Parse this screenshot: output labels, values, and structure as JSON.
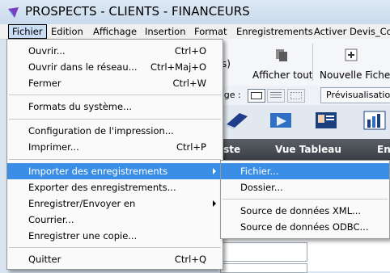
{
  "window": {
    "title": "PROSPECTS - CLIENTS - FINANCEURS"
  },
  "menubar": {
    "items": [
      "Fichier",
      "Edition",
      "Affichage",
      "Insertion",
      "Format",
      "Enregistrements",
      "Activer Devis_Co"
    ]
  },
  "toolbar": {
    "partial_text": "s)",
    "show_all_label": "Afficher tout",
    "new_record_label": "Nouvelle Fiche",
    "layout_label_partial": "age :",
    "preview_button": "Prévisualisation"
  },
  "view_bar": {
    "list_partial": "iste",
    "table_view": "Vue Tableau",
    "partial_right": "En"
  },
  "file_menu": {
    "items": [
      {
        "label": "Ouvrir...",
        "shortcut": "Ctrl+O"
      },
      {
        "label": "Ouvrir dans le réseau...",
        "shortcut": "Ctrl+Maj+O"
      },
      {
        "label": "Fermer",
        "shortcut": "Ctrl+W"
      },
      {
        "label": "Formats du système...",
        "shortcut": ""
      },
      {
        "label": "Configuration de l'impression...",
        "shortcut": ""
      },
      {
        "label": "Imprimer...",
        "shortcut": "Ctrl+P"
      },
      {
        "label": "Importer des enregistrements",
        "shortcut": ""
      },
      {
        "label": "Exporter des enregistrements...",
        "shortcut": ""
      },
      {
        "label": "Enregistrer/Envoyer en",
        "shortcut": ""
      },
      {
        "label": "Courrier...",
        "shortcut": ""
      },
      {
        "label": "Enregistrer une copie...",
        "shortcut": ""
      },
      {
        "label": "Quitter",
        "shortcut": "Ctrl+Q"
      }
    ]
  },
  "import_submenu": {
    "items": [
      {
        "label": "Fichier..."
      },
      {
        "label": "Dossier..."
      },
      {
        "label": "Source de données XML..."
      },
      {
        "label": "Source de données ODBC..."
      }
    ]
  },
  "colors": {
    "highlight": "#3a8ee6",
    "menu_bg": "#fafafa",
    "title_bg": "#c9daec"
  }
}
